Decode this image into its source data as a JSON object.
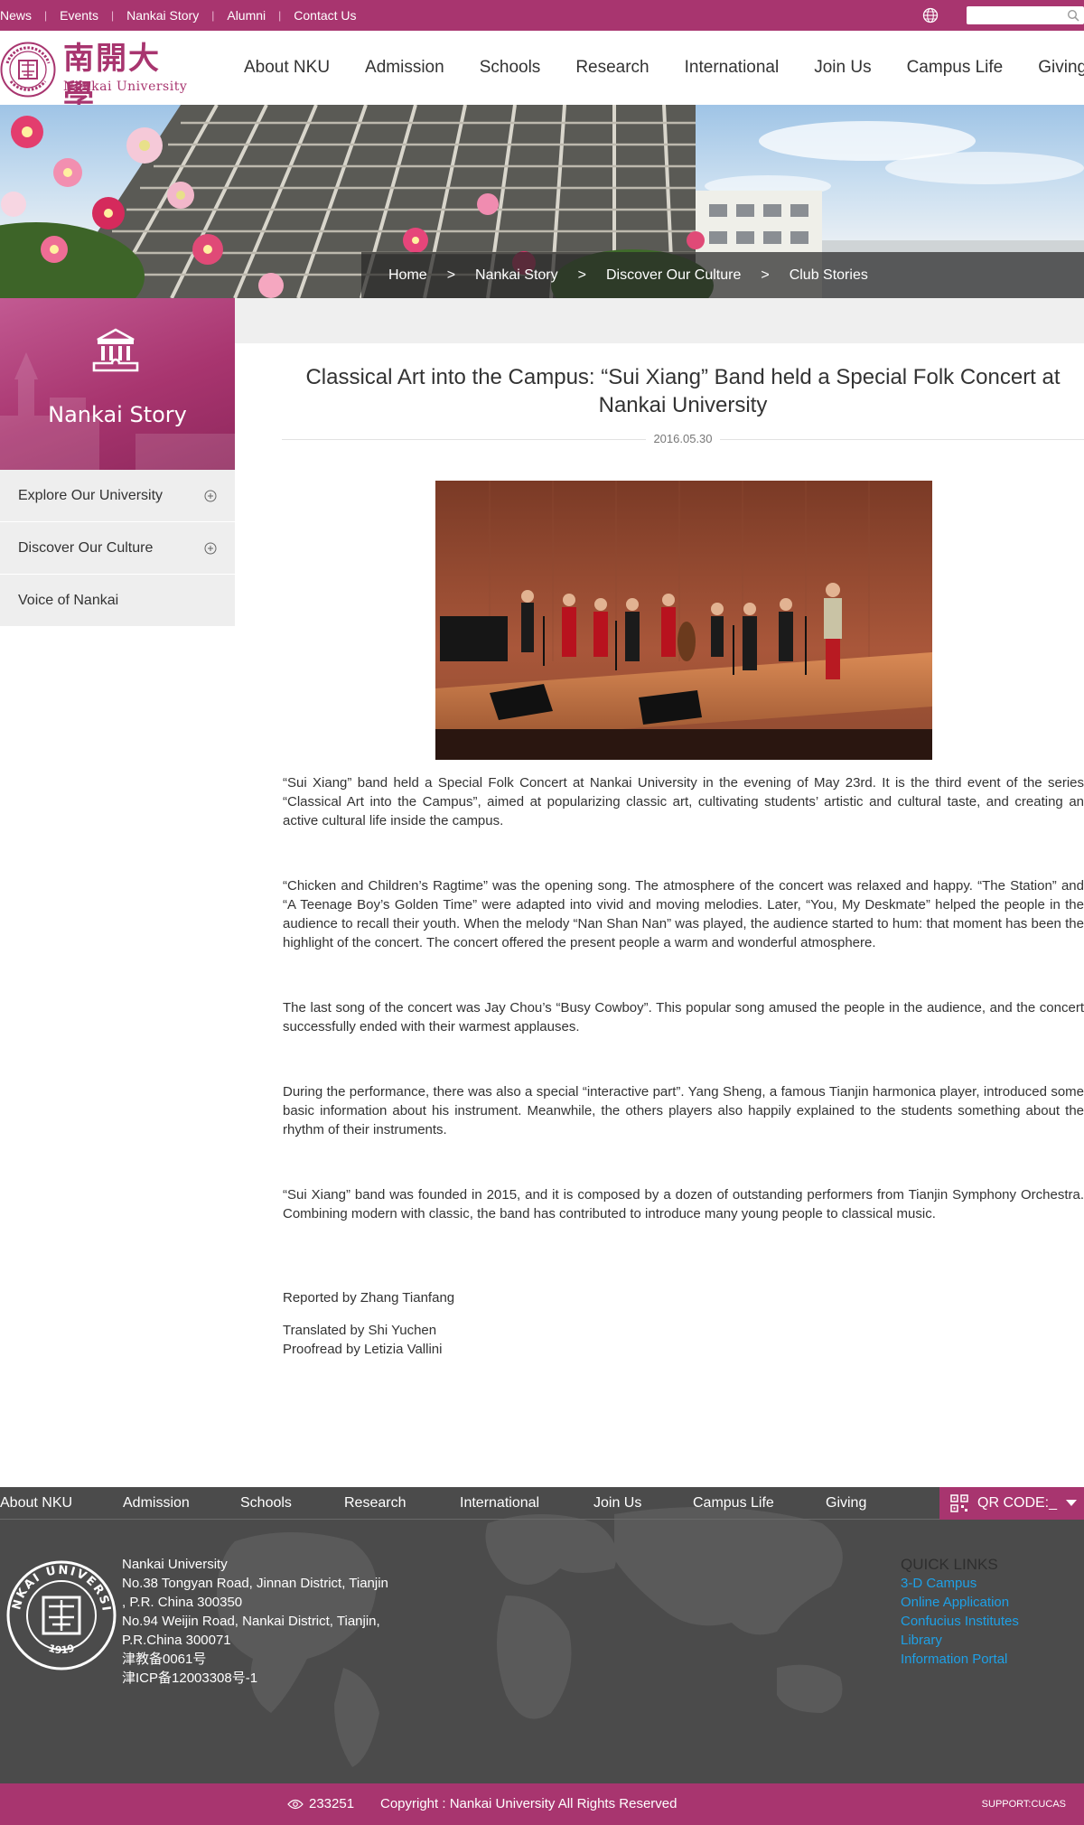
{
  "topbar": {
    "links": [
      "News",
      "Events",
      "Nankai Story",
      "Alumni",
      "Contact Us"
    ],
    "search_placeholder": ""
  },
  "header": {
    "logo_cn": "南開大學",
    "logo_en": "Nankai University",
    "seal_year": "1919",
    "nav": [
      "About NKU",
      "Admission",
      "Schools",
      "Research",
      "International",
      "Join Us",
      "Campus Life",
      "Giving"
    ]
  },
  "breadcrumb": {
    "items": [
      "Home",
      "Nankai Story",
      "Discover Our Culture",
      "Club Stories"
    ],
    "separator": ">"
  },
  "sidebar": {
    "title": "Nankai Story",
    "items": [
      {
        "label": "Explore Our University",
        "expandable": true
      },
      {
        "label": "Discover Our Culture",
        "expandable": true
      },
      {
        "label": "Voice of Nankai",
        "expandable": false
      }
    ]
  },
  "article": {
    "title": "Classical Art into the Campus: “Sui Xiang” Band held a Special Folk Concert at Nankai University",
    "date": "2016.05.30",
    "paragraphs": [
      "“Sui Xiang” band held a Special Folk Concert at Nankai University in the evening of May 23rd. It is the third event of the series “Classical Art into the Campus”, aimed at popularizing classic art, cultivating students’ artistic and cultural taste, and creating an active cultural life inside the campus.",
      " “Chicken and Children’s Ragtime” was the opening song. The atmosphere of the concert was relaxed and happy. “The Station” and “A Teenage Boy’s Golden Time” were adapted into vivid and moving melodies. Later, “You, My Deskmate” helped the people in the audience to recall their youth. When the melody “Nan Shan Nan” was played, the audience started to hum: that moment has been the highlight of the concert. The concert offered the present people a warm and wonderful atmosphere.",
      "The last song of the concert was Jay Chou’s “Busy Cowboy”. This popular song amused the people in the audience, and the concert successfully ended with their warmest applauses.",
      "During the performance, there was also a special “interactive part”. Yang Sheng, a famous Tianjin harmonica player, introduced some basic information about his instrument. Meanwhile, the others players also happily explained to the students something about the rhythm of their instruments.",
      "“Sui Xiang” band was founded in 2015, and it is composed by a dozen of outstanding performers from Tianjin Symphony Orchestra. Combining modern with classic, the band has contributed to introduce many young people to classical music."
    ],
    "reported_by": "Reported by Zhang Tianfang",
    "translated_by": "Translated by Shi Yuchen",
    "proofread_by": "Proofread by Letizia Vallini"
  },
  "footer": {
    "nav": [
      "About NKU",
      "Admission",
      "Schools",
      "Research",
      "International",
      "Join Us",
      "Campus Life",
      "Giving"
    ],
    "qr_label": "QR CODE:_",
    "seal_text": "NANKAI UNIVERSITY",
    "seal_year": "1919",
    "address": [
      "Nankai University",
      "No.38 Tongyan Road, Jinnan District, Tianjin",
      ", P.R. China 300350",
      "No.94 Weijin Road,  Nankai District, Tianjin,",
      "P.R.China  300071",
      "津教备0061号",
      "津ICP备12003308号-1"
    ],
    "quick_links_title": "QUICK LINKS",
    "quick_links": [
      "3-D Campus",
      "Online Application",
      "Confucius Institutes",
      "Library",
      "Information Portal"
    ],
    "visits": "233251",
    "copyright": "Copyright : Nankai University All Rights Reserved",
    "support": "SUPPORT:CUCAS"
  },
  "colors": {
    "brand": "#a8356f",
    "footer_bg": "#4b4b4b",
    "link_blue": "#1ea0e6"
  }
}
